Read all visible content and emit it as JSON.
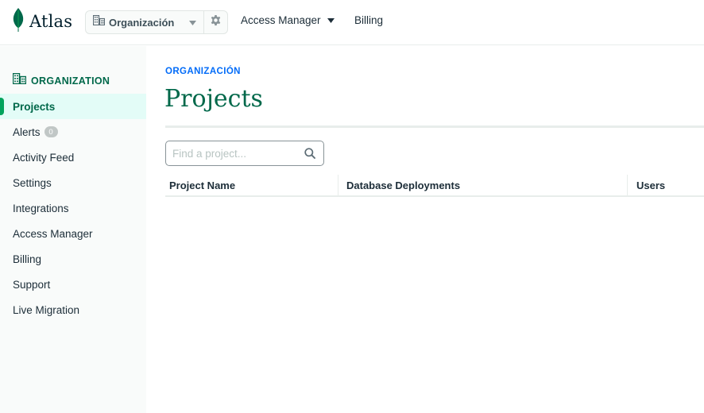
{
  "brand": {
    "name": "Atlas",
    "leaf_color": "#00684a",
    "icon": "leaf-icon"
  },
  "org_picker": {
    "name": "Organización",
    "icon": "building-icon",
    "caret_icon": "caret-down-icon",
    "settings_icon": "gear-icon"
  },
  "topnav": {
    "access_manager": "Access Manager",
    "billing": "Billing"
  },
  "sidebar": {
    "header": "ORGANIZATION",
    "header_icon": "building-icon",
    "items": [
      {
        "label": "Projects",
        "active": true
      },
      {
        "label": "Alerts",
        "badge": "0"
      },
      {
        "label": "Activity Feed"
      },
      {
        "label": "Settings"
      },
      {
        "label": "Integrations"
      },
      {
        "label": "Access Manager"
      },
      {
        "label": "Billing"
      },
      {
        "label": "Support"
      },
      {
        "label": "Live Migration"
      }
    ]
  },
  "main": {
    "breadcrumb": "ORGANIZACIÓN",
    "title": "Projects",
    "search_placeholder": "Find a project...",
    "search_value": "",
    "table": {
      "columns": [
        "Project Name",
        "Database Deployments",
        "Users"
      ],
      "rows": []
    }
  },
  "colors": {
    "accent_green": "#00684a",
    "active_bg": "#e3fcf7",
    "link_blue": "#016bf8"
  }
}
